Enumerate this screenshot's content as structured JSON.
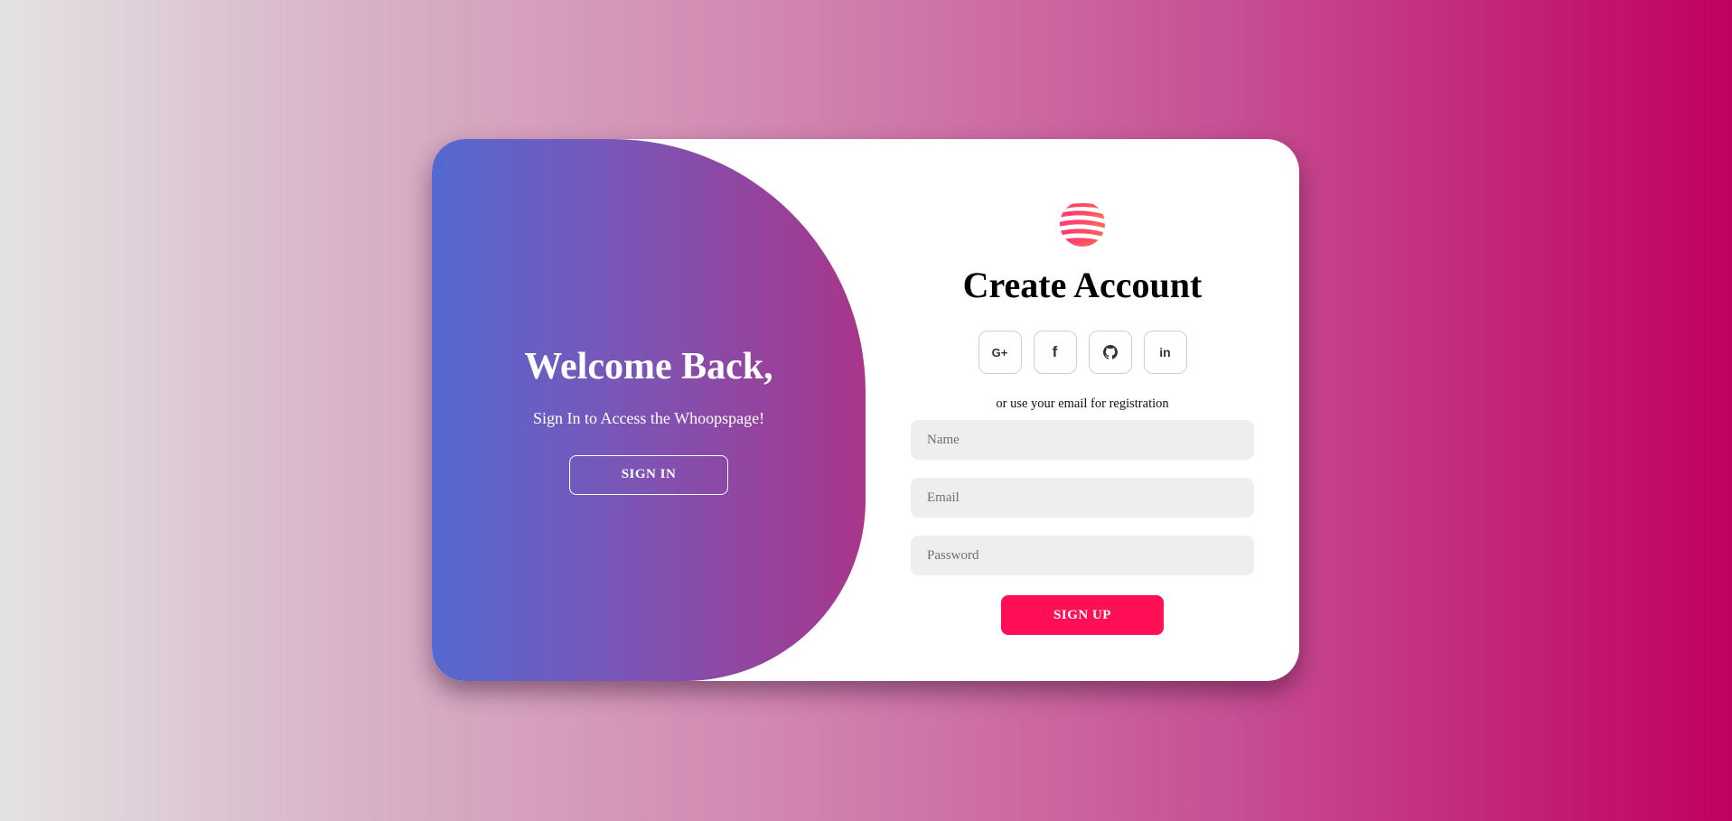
{
  "overlay": {
    "title": "Welcome Back,",
    "subtitle": "Sign In to Access the Whoopspage!",
    "button_label": "SIGN IN"
  },
  "form": {
    "logo_icon": "striped-globe-icon",
    "title": "Create Account",
    "socials": [
      {
        "icon": "google-plus-icon",
        "glyph": "G+"
      },
      {
        "icon": "facebook-icon",
        "glyph": "f"
      },
      {
        "icon": "github-icon",
        "glyph": ""
      },
      {
        "icon": "linkedin-icon",
        "glyph": "in"
      }
    ],
    "helper_text": "or use your email for registration",
    "fields": {
      "name_placeholder": "Name",
      "email_placeholder": "Email",
      "password_placeholder": "Password"
    },
    "button_label": "SIGN UP"
  },
  "colors": {
    "accent": "#ff0f55",
    "overlay_start": "#5469d1",
    "overlay_end": "#a8368a",
    "background_end": "#c0005f"
  }
}
